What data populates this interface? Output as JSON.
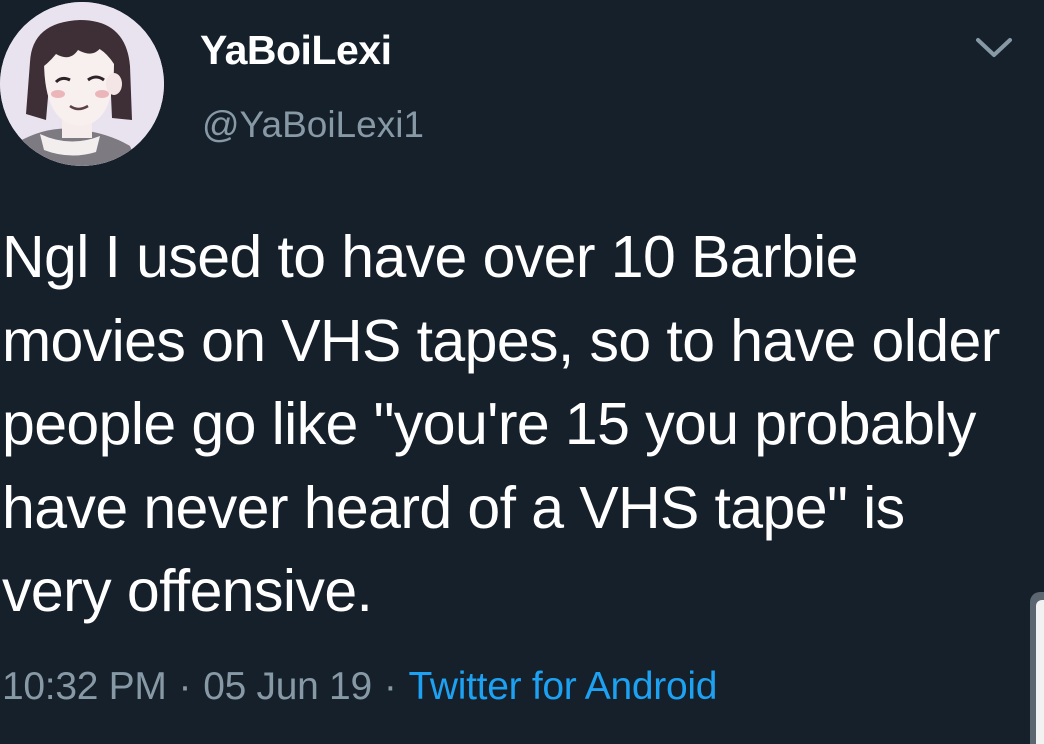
{
  "tweet": {
    "display_name": "YaBoiLexi",
    "handle": "@YaBoiLexi1",
    "text": "Ngl I used to have over 10 Barbie movies on VHS tapes, so to have older people go like \"you're 15 you probably have never heard of a VHS tape\" is very offensive.",
    "time": "10:32 PM",
    "separator": "·",
    "date": "05 Jun 19",
    "source": "Twitter for Android"
  },
  "icons": {
    "avatar": "cartoon-avatar-icon",
    "menu": "chevron-down-icon"
  },
  "colors": {
    "background": "#15202b",
    "text": "#ffffff",
    "secondary_text": "#8899a6",
    "link": "#1da1f2"
  }
}
